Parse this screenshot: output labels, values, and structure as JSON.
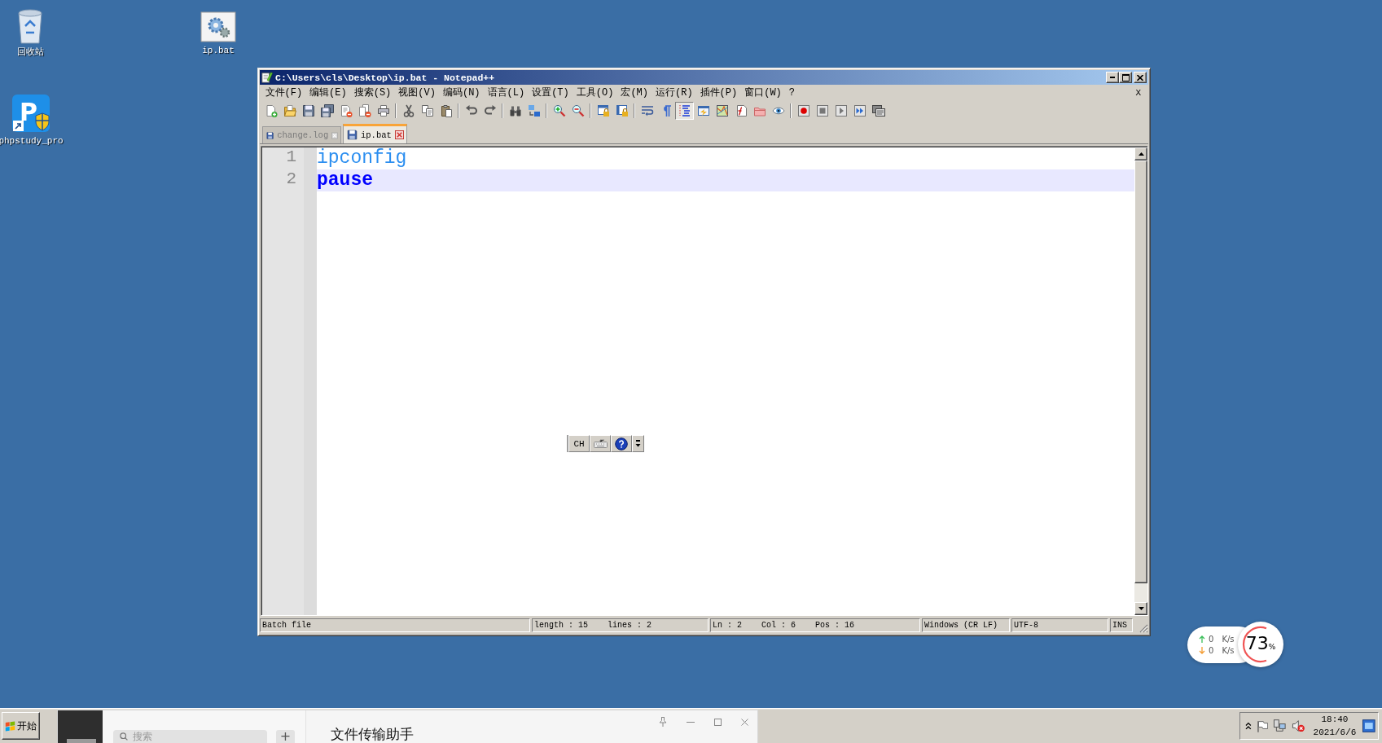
{
  "desktop_icons": [
    {
      "kind": "recycle-bin",
      "label": "回收站"
    },
    {
      "kind": "batch-file",
      "label": "ip.bat"
    },
    {
      "kind": "shortcut",
      "label": "phpstudy_pro",
      "logo_text": "P"
    }
  ],
  "window": {
    "title": "C:\\Users\\cls\\Desktop\\ip.bat - Notepad++"
  },
  "menu": {
    "items": [
      "文件(F)",
      "编辑(E)",
      "搜索(S)",
      "视图(V)",
      "编码(N)",
      "语言(L)",
      "设置(T)",
      "工具(O)",
      "宏(M)",
      "运行(R)",
      "插件(P)",
      "窗口(W)",
      "?"
    ],
    "close": "X"
  },
  "toolbar": [
    {
      "kind": "new",
      "pressed": false
    },
    {
      "kind": "open",
      "pressed": false
    },
    {
      "kind": "save",
      "pressed": false
    },
    {
      "kind": "save-all",
      "pressed": false
    },
    {
      "kind": "close",
      "pressed": false
    },
    {
      "kind": "close-all",
      "pressed": false
    },
    {
      "kind": "print",
      "pressed": false
    },
    {
      "kind": "separator"
    },
    {
      "kind": "cut",
      "pressed": false
    },
    {
      "kind": "copy",
      "pressed": false
    },
    {
      "kind": "paste",
      "pressed": false
    },
    {
      "kind": "separator"
    },
    {
      "kind": "undo",
      "pressed": false
    },
    {
      "kind": "redo",
      "pressed": false
    },
    {
      "kind": "separator"
    },
    {
      "kind": "find",
      "pressed": false
    },
    {
      "kind": "replace",
      "pressed": false
    },
    {
      "kind": "separator"
    },
    {
      "kind": "zoom-in",
      "pressed": false
    },
    {
      "kind": "zoom-out",
      "pressed": false
    },
    {
      "kind": "separator"
    },
    {
      "kind": "sync-vertical",
      "pressed": false
    },
    {
      "kind": "sync-horizontal",
      "pressed": false
    },
    {
      "kind": "separator"
    },
    {
      "kind": "word-wrap",
      "pressed": false
    },
    {
      "kind": "show-all-characters",
      "pressed": false
    },
    {
      "kind": "indent-guide",
      "pressed": true
    },
    {
      "kind": "user-language",
      "pressed": false
    },
    {
      "kind": "document-map",
      "pressed": false
    },
    {
      "kind": "function-list",
      "pressed": false
    },
    {
      "kind": "folder-workspace",
      "pressed": false
    },
    {
      "kind": "monitoring",
      "pressed": false
    },
    {
      "kind": "separator"
    },
    {
      "kind": "record-macro",
      "pressed": false
    },
    {
      "kind": "stop-recording",
      "pressed": false
    },
    {
      "kind": "playback",
      "pressed": false
    },
    {
      "kind": "run-macro-multiple",
      "pressed": false
    },
    {
      "kind": "save-macro",
      "pressed": false
    }
  ],
  "tabs": [
    {
      "label": "change.log",
      "selected": false
    },
    {
      "label": "ip.bat",
      "selected": true
    }
  ],
  "editor": {
    "lines": [
      {
        "number": "1",
        "text": "ipconfig",
        "kind": "command",
        "current": false
      },
      {
        "number": "2",
        "text": "pause",
        "kind": "keyword",
        "current": true
      }
    ]
  },
  "status_bar": [
    {
      "texts": [
        "Batch file"
      ]
    },
    {
      "texts": [
        "length : 15",
        "lines : 2"
      ]
    },
    {
      "texts": [
        "Ln : 2",
        "Col : 6",
        "Pos : 16"
      ]
    },
    {
      "texts": [
        "Windows (CR LF)"
      ]
    },
    {
      "texts": [
        "UTF-8"
      ]
    },
    {
      "texts": [
        "INS"
      ]
    }
  ],
  "ime_bar": {
    "language": "CH"
  },
  "net_widget": {
    "upload": "0",
    "upload_unit": "K/s",
    "download": "0",
    "download_unit": "K/s",
    "usage": "73",
    "usage_unit": "%"
  },
  "chat_window": {
    "search_placeholder": "搜索",
    "add_button": "+",
    "title": "文件传输助手"
  },
  "taskbar": {
    "start": "开始",
    "clock_time": "18:40",
    "clock_date": "2021/6/6"
  }
}
